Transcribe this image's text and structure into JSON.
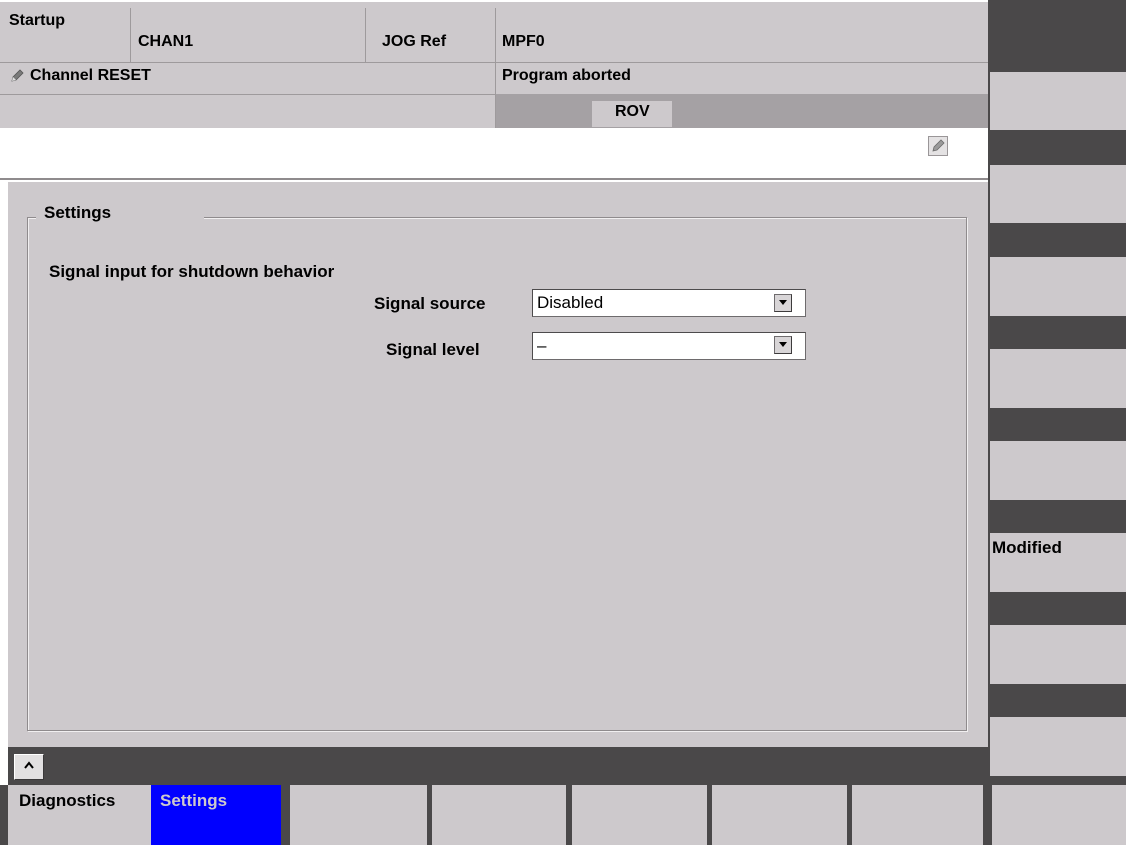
{
  "header": {
    "area": "Startup",
    "channel": "CHAN1",
    "mode": "JOG Ref",
    "program": "MPF0",
    "channel_status": "Channel RESET",
    "program_status": "Program aborted",
    "rov": "ROV"
  },
  "panel": {
    "group_title": "Settings",
    "section_title": "Signal input for shutdown behavior",
    "signal_source_label": "Signal source",
    "signal_source_value": "Disabled",
    "signal_level_label": "Signal level",
    "signal_level_value": "–"
  },
  "vertical_softkeys": [
    "",
    "",
    "",
    "",
    "",
    "Modified",
    "",
    ""
  ],
  "horizontal_softkeys": [
    "Diagnostics",
    "Settings",
    "",
    "",
    "",
    "",
    "",
    ""
  ],
  "colors": {
    "background": "#cdc9cc",
    "separator": "#4a4849",
    "active_softkey": "#0000ff",
    "rov_band": "#a5a1a4"
  },
  "icons": [
    "pencil-icon",
    "chevron-down-icon",
    "recall-up-icon"
  ]
}
